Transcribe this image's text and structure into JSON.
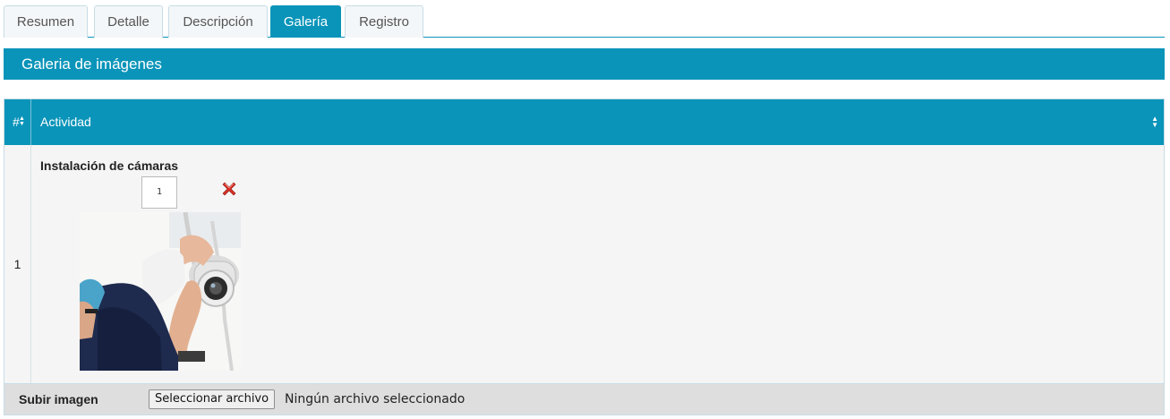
{
  "tabs": [
    {
      "label": "Resumen"
    },
    {
      "label": "Detalle"
    },
    {
      "label": "Descripción"
    },
    {
      "label": "Galería"
    },
    {
      "label": "Registro"
    }
  ],
  "active_tab": "Galería",
  "panel": {
    "title": "Galeria de imágenes"
  },
  "table": {
    "columns": {
      "number": "#",
      "activity": "Actividad"
    },
    "rows": [
      {
        "number": "1",
        "activity": "Instalación de cámaras",
        "images": [
          {
            "order": "1",
            "delete_icon": "red-x-icon",
            "thumbnail": "security-camera-installation-photo"
          }
        ]
      }
    ]
  },
  "upload": {
    "label": "Subir imagen",
    "button": "Seleccionar archivo",
    "status": "Ningún archivo seleccionado"
  },
  "colors": {
    "accent": "#0a94b9",
    "delete": "#d93025"
  }
}
